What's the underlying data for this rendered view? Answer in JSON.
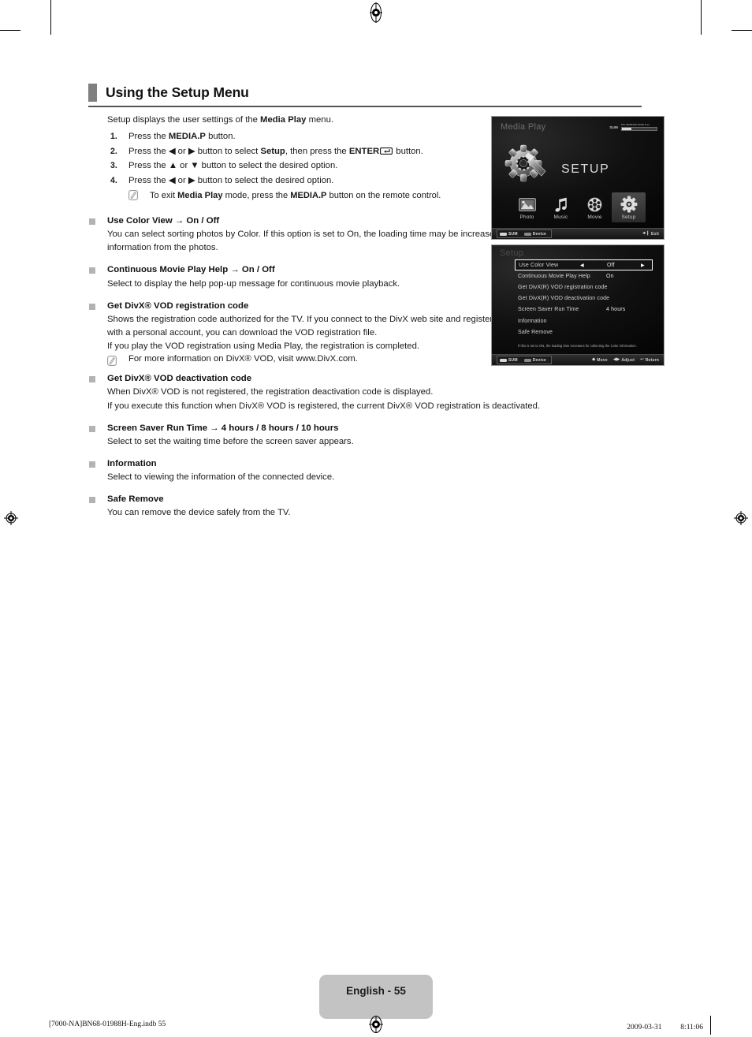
{
  "heading": {
    "title": "Using the Setup Menu"
  },
  "intro": {
    "before": "Setup displays the user settings of the ",
    "bold": "Media Play",
    "after": " menu."
  },
  "steps": [
    {
      "num": "1.",
      "html": "Press the <b>MEDIA.P</b> button."
    },
    {
      "num": "2.",
      "html": "Press the ◀ or ▶ button to select <b>Setup</b>, then press the <b>ENTER</b><span class=\"enter-key\"></span> button."
    },
    {
      "num": "3.",
      "html": "Press the ▲ or ▼ button to select the desired option."
    },
    {
      "num": "4.",
      "html": "Press the ◀ or ▶ button to select the desired option."
    }
  ],
  "step_note": "To exit <b>Media Play</b> mode, press the <b>MEDIA.P</b> button on the remote control.",
  "sections": [
    {
      "title": "Use Color View → On / Off",
      "body": [
        "You can select sorting photos by Color. If this option is set to On, the loading time may be increased to collect Color information from the photos."
      ],
      "note": null
    },
    {
      "title": "Continuous Movie Play Help → On / Off",
      "body": [
        "Select to display the help pop-up message for continuous movie playback."
      ],
      "note": null
    },
    {
      "title": "Get DivX® VOD registration code",
      "body": [
        "Shows the registration code authorized for the TV. If you connect to the DivX web site and register the registration code with a personal account, you can download the VOD registration file.",
        "If you play the VOD registration using Media Play, the registration is completed."
      ],
      "note": "For more information on DivX® VOD, visit www.DivX.com."
    },
    {
      "title": "Get DivX® VOD deactivation code",
      "body": [
        "When DivX® VOD is not registered, the registration deactivation code is displayed.",
        "If you execute this function when DivX® VOD is registered, the current DivX® VOD registration is deactivated."
      ],
      "note": null
    },
    {
      "title": "Screen Saver Run Time → 4 hours / 8 hours / 10 hours",
      "body": [
        "Select to set the waiting time before the screen saver appears."
      ],
      "note": null
    },
    {
      "title": "Information",
      "body": [
        "Select to viewing the information of the connected device."
      ],
      "note": null
    },
    {
      "title": "Safe Remove",
      "body": [
        "You can remove the device safely from the TV."
      ],
      "note": null
    }
  ],
  "tv_main": {
    "title": "Media Play",
    "hero_label": "SETUP",
    "storage": {
      "device_label": "SUM",
      "free_text": "851.86MB/993.50MB Free",
      "used_percent": 28
    },
    "icons": [
      {
        "name": "Photo",
        "icon": "photo-icon",
        "selected": false
      },
      {
        "name": "Music",
        "icon": "music-note-icon",
        "selected": false
      },
      {
        "name": "Movie",
        "icon": "film-reel-icon",
        "selected": false
      },
      {
        "name": "Setup",
        "icon": "gear-icon",
        "selected": true
      }
    ],
    "footer": {
      "source_key": "SUM",
      "device_key": "Device",
      "exit_key": "Exit"
    }
  },
  "tv_menu": {
    "title": "Setup",
    "rows": [
      {
        "label": "Use Color View",
        "value": "Off",
        "selected": true,
        "arrows": true
      },
      {
        "label": "Continuous Movie Play Help",
        "value": "On",
        "selected": false,
        "arrows": false
      },
      {
        "label": "Get DivX(R) VOD registration code",
        "value": "",
        "selected": false,
        "arrows": false
      },
      {
        "label": "Get DivX(R) VOD deactivation code",
        "value": "",
        "selected": false,
        "arrows": false
      },
      {
        "label": "Screen Saver Run Time",
        "value": "4 hours",
        "selected": false,
        "arrows": false
      },
      {
        "label": "Information",
        "value": "",
        "selected": false,
        "arrows": false
      },
      {
        "label": "Safe Remove",
        "value": "",
        "selected": false,
        "arrows": false
      }
    ],
    "help_text": "If this is set to ON, the loading time increases for collecting the Color information.",
    "footer": {
      "source_key": "SUM",
      "device_key": "Device",
      "move_key": "Move",
      "adjust_key": "Adjust",
      "return_key": "Return"
    }
  },
  "page_footer": {
    "page_label": "English - 55",
    "file_ref": "[7000-NA]BN68-01988H-Eng.indb   55",
    "timestamp": "2009-03-31   　　 8:11:06"
  },
  "colors": {
    "heading_bar": "#808080",
    "bullet": "#b3b3b3",
    "page_badge": "#c3c3c3"
  }
}
